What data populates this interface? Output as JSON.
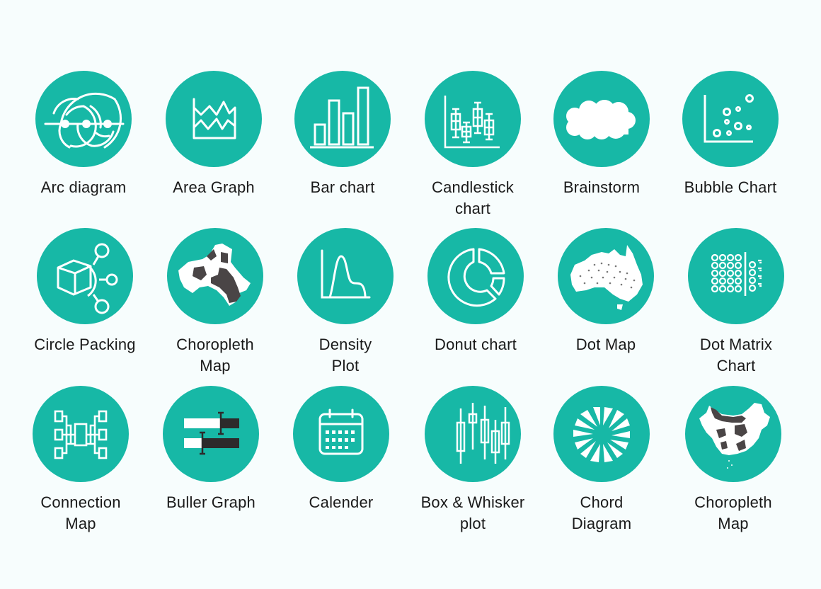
{
  "accent_color": "#17b8a6",
  "dark_fill": "#4a4546",
  "tiles": [
    {
      "label": "Arc diagram",
      "icon": "arc-diagram-icon"
    },
    {
      "label": "Area Graph",
      "icon": "area-graph-icon"
    },
    {
      "label": "Bar chart",
      "icon": "bar-chart-icon"
    },
    {
      "label": "Candlestick chart",
      "icon": "candlestick-chart-icon"
    },
    {
      "label": "Brainstorm",
      "icon": "cloud-icon"
    },
    {
      "label": "Bubble Chart",
      "icon": "bubble-chart-icon"
    },
    {
      "label": "Circle Packing",
      "icon": "circle-packing-icon"
    },
    {
      "label": "Choropleth Map",
      "icon": "choropleth-map-icon"
    },
    {
      "label": "Density Plot",
      "icon": "density-plot-icon"
    },
    {
      "label": "Donut chart",
      "icon": "donut-chart-icon"
    },
    {
      "label": "Dot Map",
      "icon": "dot-map-icon"
    },
    {
      "label": "Dot Matrix Chart",
      "icon": "dot-matrix-chart-icon"
    },
    {
      "label": "Connection Map",
      "icon": "connection-map-icon"
    },
    {
      "label": "Buller Graph",
      "icon": "bullet-graph-icon"
    },
    {
      "label": "Calender",
      "icon": "calendar-icon"
    },
    {
      "label": "Box & Whisker plot",
      "icon": "box-whisker-plot-icon"
    },
    {
      "label": "Chord Diagram",
      "icon": "chord-diagram-icon"
    },
    {
      "label": "Choropleth Map",
      "icon": "choropleth-map-icon"
    }
  ]
}
